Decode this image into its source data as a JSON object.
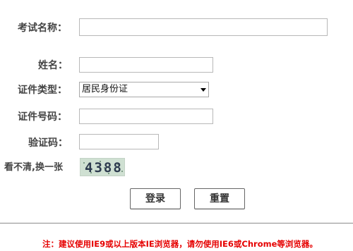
{
  "form": {
    "exam_name": {
      "label": "考试名称：",
      "value": "",
      "placeholder": ""
    },
    "name": {
      "label": "姓名：",
      "value": "",
      "placeholder": ""
    },
    "id_type": {
      "label": "证件类型：",
      "selected": "居民身份证"
    },
    "id_number": {
      "label": "证件号码：",
      "value": "",
      "placeholder": ""
    },
    "captcha": {
      "label": "验证码：",
      "value": "",
      "placeholder": ""
    }
  },
  "captcha_refresh_label": "看不清,换一张",
  "captcha_image_text": "4388",
  "buttons": {
    "login": "登录",
    "reset": "重置"
  },
  "notice": "注：建议使用IE9或以上版本IE浏览器，请勿使用IE6或Chrome等浏览器。",
  "colors": {
    "notice": "#e60000",
    "label": "#444444",
    "captcha_bg": "#cfe0d2"
  },
  "icons": {
    "select_arrow": "chevron-down-icon"
  }
}
